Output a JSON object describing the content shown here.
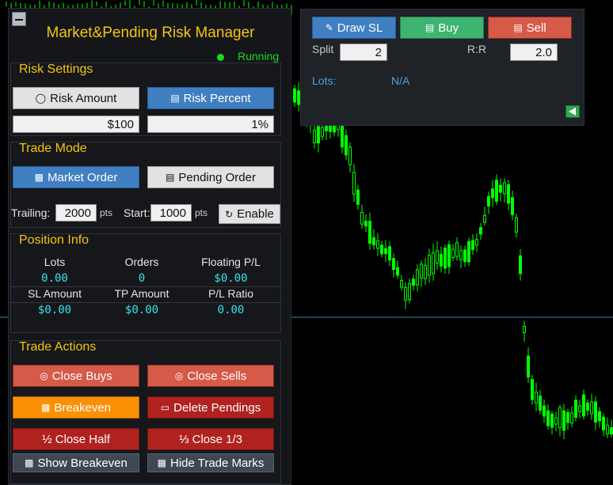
{
  "panel": {
    "title": "Market&Pending Risk Manager",
    "status": "Running"
  },
  "risk": {
    "title": "Risk Settings",
    "amount_btn": "Risk Amount",
    "percent_btn": "Risk Percent",
    "amount_value": "$100",
    "percent_value": "1%"
  },
  "trade_mode": {
    "title": "Trade Mode",
    "market_btn": "Market Order",
    "pending_btn": "Pending Order",
    "trailing_label": "Trailing:",
    "trailing_value": "2000",
    "pts1": "pts",
    "start_label": "Start:",
    "start_value": "1000",
    "pts2": "pts",
    "enable_btn": "Enable"
  },
  "position": {
    "title": "Position Info",
    "headers1": [
      "Lots",
      "Orders",
      "Floating P/L"
    ],
    "values1": [
      "0.00",
      "0",
      "$0.00"
    ],
    "headers2": [
      "SL Amount",
      "TP Amount",
      "P/L Ratio"
    ],
    "values2": [
      "$0.00",
      "$0.00",
      "0.00"
    ]
  },
  "actions": {
    "title": "Trade Actions",
    "close_buys": "Close Buys",
    "close_sells": "Close Sells",
    "breakeven": "Breakeven",
    "delete_pendings": "Delete Pendings",
    "close_half": "½ Close Half",
    "close_third": "⅓ Close 1/3",
    "show_breakeven": "Show Breakeven",
    "hide_marks": "Hide Trade Marks"
  },
  "top_panel": {
    "draw_sl": "Draw SL",
    "buy": "Buy",
    "sell": "Sell",
    "split_label": "Split",
    "split_value": "2",
    "rr_label": "R:R",
    "rr_value": "2.0",
    "lots_label": "Lots:",
    "lots_value": "N/A"
  },
  "colors": {
    "accent_yellow": "#f3c50f",
    "running_green": "#1adb1a",
    "value_cyan": "#38e3e8",
    "candle_green": "#00ff00",
    "blue_button": "#3f7fc2",
    "red_button": "#d65a48"
  },
  "icons": {
    "risk_amount": "money-bag-icon",
    "risk_percent": "bar-chart-icon",
    "market_order": "chart-icon",
    "pending_order": "document-icon",
    "enable": "refresh-icon",
    "close": "circle-icon",
    "breakeven": "square-icon",
    "delete": "trash-icon",
    "draw_sl": "pencil-icon",
    "buy": "chart-up-icon",
    "sell": "chart-down-icon",
    "collapse": "arrow-left-icon"
  }
}
